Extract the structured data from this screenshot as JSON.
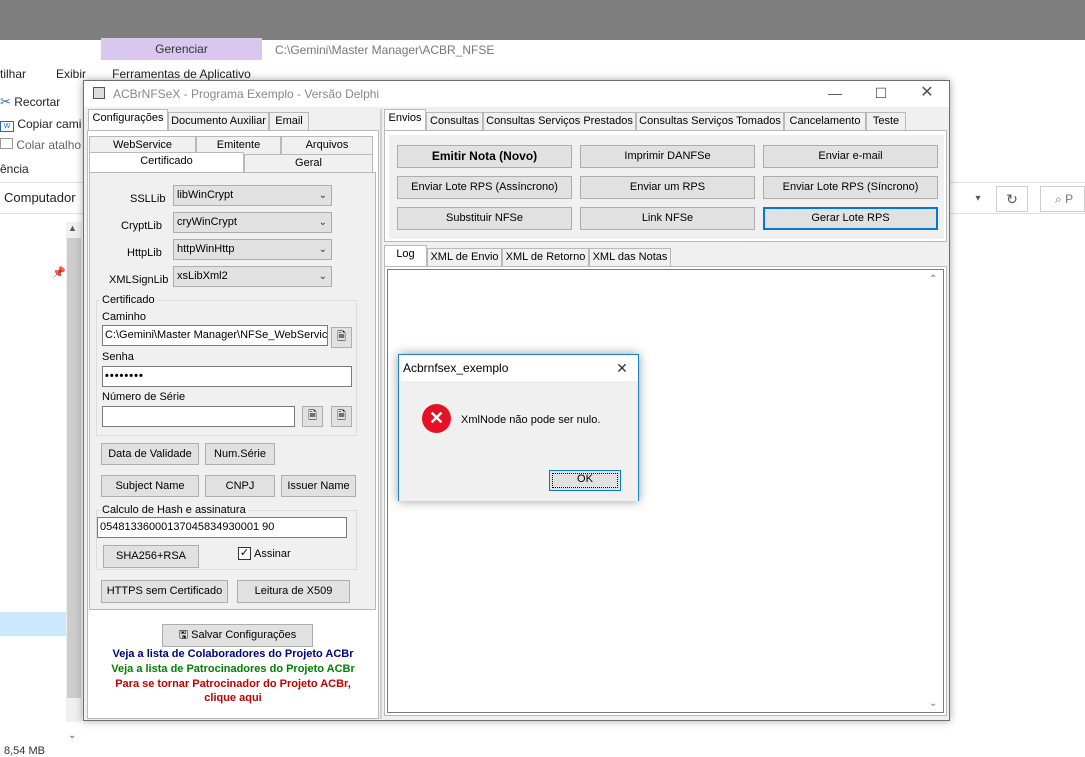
{
  "explorer": {
    "gerenciar": "Gerenciar",
    "ferramentas": "Ferramentas de Aplicativo",
    "path_title": "C:\\Gemini\\Master Manager\\ACBR_NFSE",
    "tab_tilhar": "tilhar",
    "tab_exibir": "Exibir",
    "recortar": "Recortar",
    "copiar": "Copiar cami",
    "colar": "Colar atalho",
    "encia": "ência",
    "computador": "Computador",
    "status_size": "8,54 MB"
  },
  "app": {
    "title": "ACBrNFSeX - Programa Exemplo - Versão Delphi",
    "left_tabs": [
      "Configurações",
      "Documento Auxiliar",
      "Email"
    ],
    "config_tabs_row1": [
      "WebService",
      "Emitente",
      "Arquivos"
    ],
    "config_tabs_row2": [
      "Certificado",
      "Geral"
    ],
    "ssllib_label": "SSLLib",
    "ssllib_value": "libWinCrypt",
    "cryptlib_label": "CryptLib",
    "cryptlib_value": "cryWinCrypt",
    "httplib_label": "HttpLib",
    "httplib_value": "httpWinHttp",
    "xmlsignlib_label": "XMLSignLib",
    "xmlsignlib_value": "xsLibXml2",
    "cert_group": "Certificado",
    "caminho_label": "Caminho",
    "caminho_value": "C:\\Gemini\\Master Manager\\NFSe_WebService",
    "senha_label": "Senha",
    "senha_value": "••••••••",
    "num_serie_label": "Número de Série",
    "num_serie_value": "",
    "btn_data_validade": "Data de Validade",
    "btn_num_serie": "Num.Série",
    "btn_subject": "Subject Name",
    "btn_cnpj": "CNPJ",
    "btn_issuer": "Issuer Name",
    "hash_group": "Calculo de Hash e assinatura",
    "hash_value": "05481336000137045834930001 90",
    "btn_sha": "SHA256+RSA",
    "assinar_label": "Assinar",
    "btn_https": "HTTPS sem Certificado",
    "btn_x509": "Leitura de X509",
    "btn_salvar": "Salvar Configurações",
    "link_colab": "Veja a lista de Colaboradores do Projeto ACBr",
    "link_patroc": "Veja a lista de Patrocinadores do Projeto ACBr",
    "link_tornar": "Para se tornar Patrocinador do Projeto ACBr,",
    "link_clique": "clique aqui",
    "right_tabs": [
      "Envios",
      "Consultas",
      "Consultas Serviços Prestados",
      "Consultas Serviços Tomados",
      "Cancelamento",
      "Teste"
    ],
    "btn_emitir": "Emitir Nota (Novo)",
    "btn_imprimir": "Imprimir DANFSe",
    "btn_enviar_email": "Enviar e-mail",
    "btn_lote_assinc": "Enviar Lote RPS (Assíncrono)",
    "btn_enviar_rps": "Enviar um RPS",
    "btn_lote_sinc": "Enviar Lote RPS (Síncrono)",
    "btn_substituir": "Substituir NFSe",
    "btn_link": "Link NFSe",
    "btn_gerar_lote": "Gerar Lote RPS",
    "log_tabs": [
      "Log",
      "XML de Envio",
      "XML de Retorno",
      "XML das Notas"
    ]
  },
  "dialog": {
    "title": "Acbrnfsex_exemplo",
    "message": "XmlNode não pode ser nulo.",
    "ok": "OK"
  },
  "colors": {
    "accent": "#0078d7",
    "link_blue": "#000080",
    "link_green": "#008000",
    "link_red": "#c00000",
    "error_red": "#e81123"
  }
}
